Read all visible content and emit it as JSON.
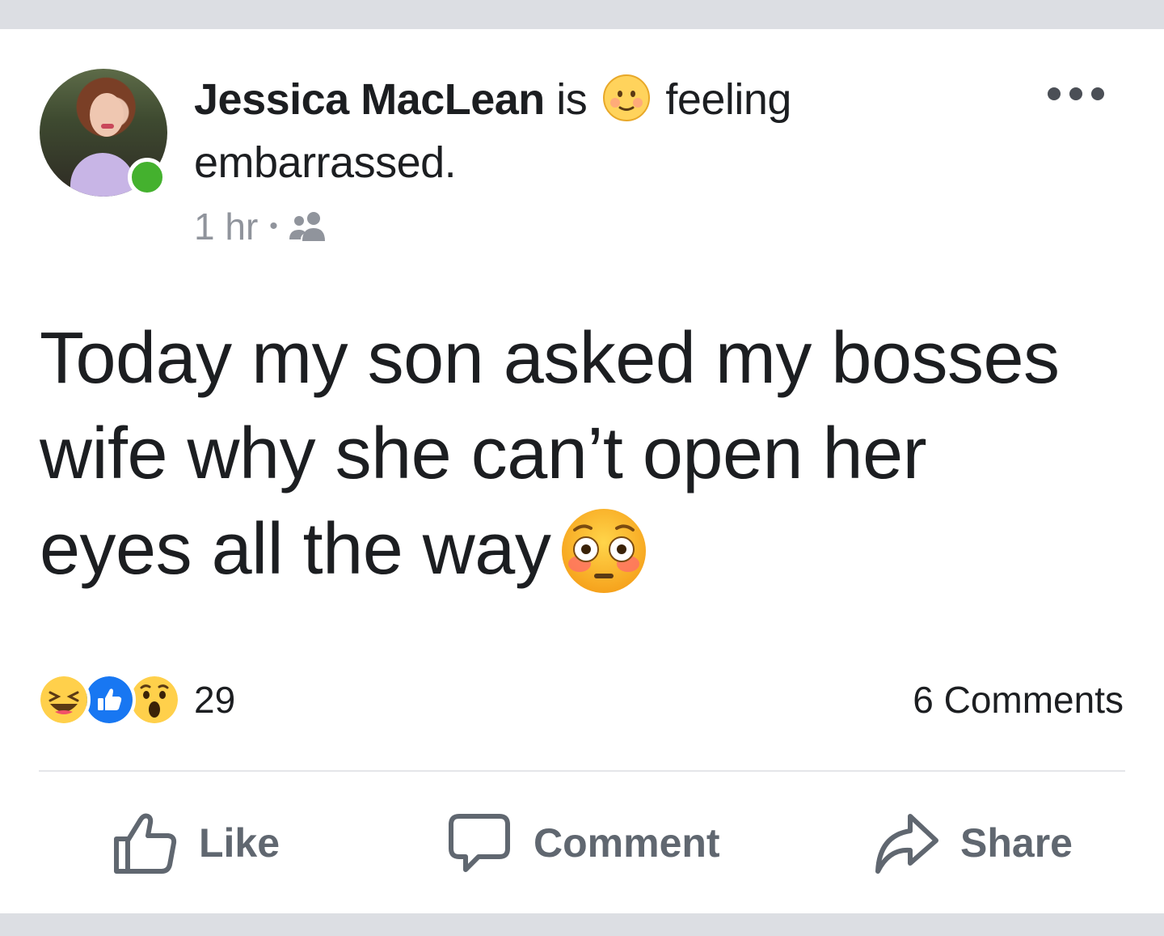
{
  "post": {
    "author": "Jessica MacLean",
    "verb": "is",
    "feeling_word": "feeling",
    "feeling": "embarrassed.",
    "time": "1 hr",
    "separator": "•",
    "audience_icon": "friends-icon",
    "text_line1": "Today my son asked my bosses",
    "text_line2": "wife why she can’t open her",
    "text_line3": "eyes all the way",
    "text_emoji": "flushed-face-emoji"
  },
  "reactions": {
    "icons": [
      "laughing-reaction-icon",
      "like-reaction-icon",
      "wow-reaction-icon"
    ],
    "count": "29"
  },
  "comments": {
    "label": "6 Comments"
  },
  "actions": {
    "like": "Like",
    "comment": "Comment",
    "share": "Share"
  },
  "colors": {
    "text": "#1c1e21",
    "muted": "#90949c",
    "action": "#606770",
    "online": "#44b12e",
    "like_blue": "#1877f2",
    "frame": "#dcdee3"
  }
}
